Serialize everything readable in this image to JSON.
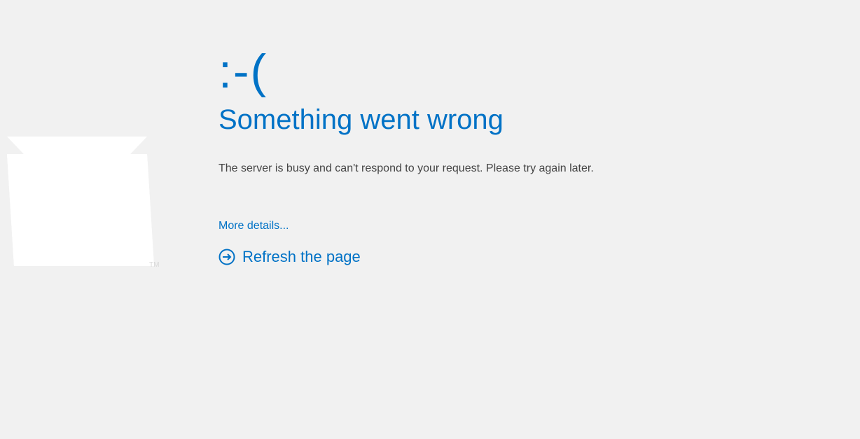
{
  "error": {
    "sad_face": ":-(",
    "heading": "Something went wrong",
    "message": "The server is busy and can't respond to your request. Please try again later.",
    "more_details": "More details...",
    "refresh": "Refresh the page"
  },
  "colors": {
    "accent": "#0072c6",
    "background": "#f1f1f1",
    "text": "#444"
  }
}
